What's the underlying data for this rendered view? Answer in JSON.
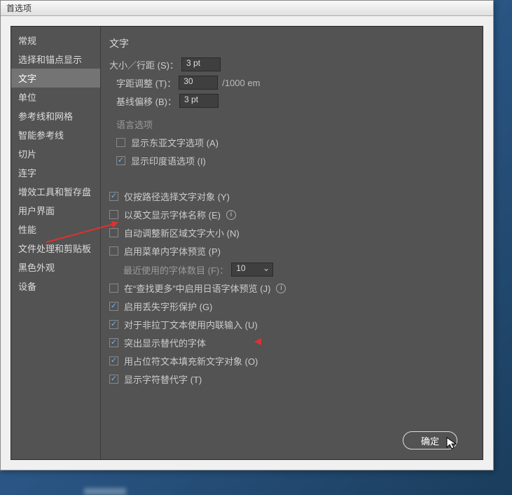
{
  "window": {
    "title": "首选项"
  },
  "sidebar": {
    "items": [
      {
        "label": "常规"
      },
      {
        "label": "选择和锚点显示"
      },
      {
        "label": "文字",
        "selected": true
      },
      {
        "label": "单位"
      },
      {
        "label": "参考线和网格"
      },
      {
        "label": "智能参考线"
      },
      {
        "label": "切片"
      },
      {
        "label": "连字"
      },
      {
        "label": "增效工具和暂存盘"
      },
      {
        "label": "用户界面"
      },
      {
        "label": "性能"
      },
      {
        "label": "文件处理和剪贴板"
      },
      {
        "label": "黑色外观"
      },
      {
        "label": "设备"
      }
    ]
  },
  "pane": {
    "title": "文字",
    "size_leading": {
      "label": "大小／行距 (S)：",
      "value": "3 pt"
    },
    "tracking": {
      "label": "字距调整 (T)：",
      "value": "30",
      "unit": "/1000 em"
    },
    "baseline": {
      "label": "基线偏移 (B)：",
      "value": "3 pt"
    },
    "lang_header": "语言选项",
    "lang_opts": [
      {
        "label": "显示东亚文字选项 (A)",
        "checked": false
      },
      {
        "label": "显示印度语选项 (I)",
        "checked": true
      }
    ],
    "opts1": [
      {
        "label": "仅按路径选择文字对象 (Y)",
        "checked": true
      },
      {
        "label": "以英文显示字体名称 (E)",
        "checked": false,
        "info": true
      },
      {
        "label": "自动调整新区域文字大小 (N)",
        "checked": false
      },
      {
        "label": "启用菜单内字体预览 (P)",
        "checked": false
      }
    ],
    "recent": {
      "label": "最近使用的字体数目 (F)：",
      "value": "10"
    },
    "opts2": [
      {
        "label": "在“查找更多”中启用日语字体预览 (J)",
        "checked": false,
        "info": true
      },
      {
        "label": "启用丢失字形保护 (G)",
        "checked": true
      },
      {
        "label": "对于非拉丁文本使用内联输入 (U)",
        "checked": true
      },
      {
        "label": "突出显示替代的字体",
        "checked": true
      },
      {
        "label": "用占位符文本填充新文字对象 (O)",
        "checked": true
      },
      {
        "label": "显示字符替代字 (T)",
        "checked": true
      }
    ]
  },
  "buttons": {
    "ok": "确定"
  }
}
